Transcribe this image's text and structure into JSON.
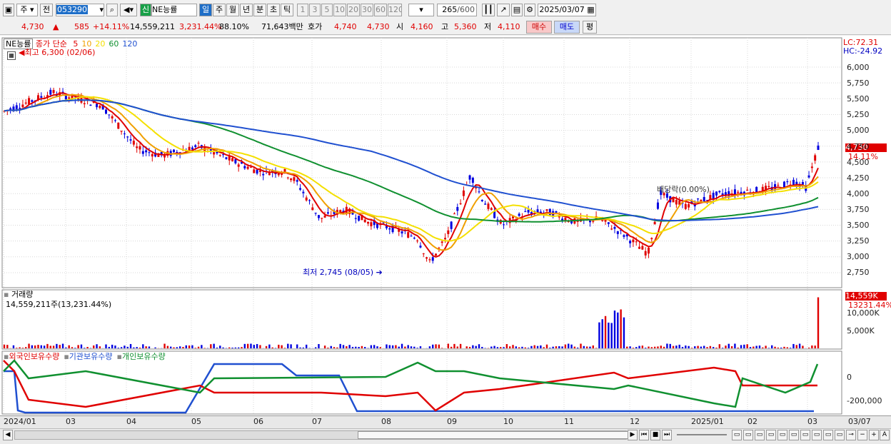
{
  "toolbar": {
    "period": "주",
    "prev": "전",
    "code": "053290",
    "new_badge": "신",
    "name": "NE능률",
    "tabs": [
      "일",
      "주",
      "월",
      "년",
      "분",
      "초",
      "틱"
    ],
    "active_tab": "일",
    "nums": [
      "1",
      "3",
      "5",
      "10",
      "20",
      "30",
      "60",
      "120"
    ],
    "count": "265",
    "count_total": "/600",
    "date": "2025/03/07"
  },
  "quote": {
    "price": "4,730",
    "change": "585",
    "change_pct": "+14.11%",
    "volume": "14,559,211",
    "vol_pct": "3,231.44%",
    "ratio": "88.10%",
    "amount": "71,643백만",
    "hoga_label": "호가",
    "hoga_ask": "4,740",
    "hoga_bid": "4,730",
    "open_label": "시",
    "open": "4,160",
    "high_label": "고",
    "high": "5,360",
    "low_label": "저",
    "low": "4,110",
    "buy": "매수",
    "sell": "매도",
    "eval": "평"
  },
  "price_panel": {
    "name": "NE능률",
    "ma_label": "종가 단순",
    "ma": [
      {
        "p": "5",
        "color": "#e00000"
      },
      {
        "p": "10",
        "color": "#f0a000"
      },
      {
        "p": "20",
        "color": "#f4e000"
      },
      {
        "p": "60",
        "color": "#109030"
      },
      {
        "p": "120",
        "color": "#2050d0"
      }
    ],
    "high_mark": "최고 6,300 (02/06)",
    "low_mark": "최저 2,745 (08/05)",
    "dividend": "배당락(0.00%)",
    "lc": "LC:72.31",
    "hc": "HC:-24.92",
    "last_price": "4,730",
    "last_pct": "14.11%",
    "y_ticks": [
      "6,000",
      "5,750",
      "5,500",
      "5,250",
      "5,000",
      "4,750",
      "4,500",
      "4,250",
      "4,000",
      "3,750",
      "3,500",
      "3,250",
      "3,000",
      "2,750"
    ]
  },
  "volume_panel": {
    "title": "거래량",
    "value": "14,559,211주(13,231.44%)",
    "tag": "14,559K",
    "tag_pct": "13231.44%",
    "y_ticks": [
      "10,000K",
      "5,000K"
    ]
  },
  "holding_panel": {
    "legends": [
      {
        "label": "외국인보유수량",
        "color": "#e00000"
      },
      {
        "label": "기관보유수량",
        "color": "#2050d0"
      },
      {
        "label": "개인보유수량",
        "color": "#109030"
      }
    ],
    "y_ticks": [
      "0",
      "-200,000"
    ]
  },
  "x_axis": [
    "2024/01",
    "03",
    "04",
    "05",
    "06",
    "07",
    "08",
    "09",
    "10",
    "11",
    "12",
    "2025/01",
    "02",
    "03"
  ],
  "x_axis_right": "03/07",
  "colors": {
    "up": "#e00000",
    "down": "#0000e0",
    "ma5": "#e00000",
    "ma10": "#f0a000",
    "ma20": "#f4e000",
    "ma60": "#109030",
    "ma120": "#2050d0"
  }
}
